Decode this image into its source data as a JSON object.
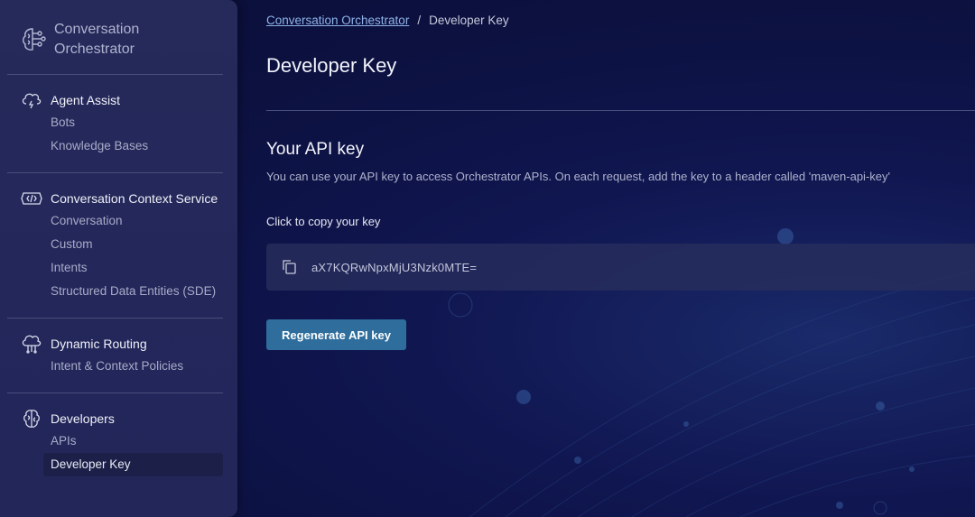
{
  "brand": {
    "name_line1": "Conversation",
    "name_line2": "Orchestrator",
    "icon": "brain-circuit-icon"
  },
  "sidebar": {
    "sections": [
      {
        "title": "Agent Assist",
        "icon": "cloud-lightning-icon",
        "items": [
          {
            "label": "Bots"
          },
          {
            "label": "Knowledge Bases"
          }
        ]
      },
      {
        "title": "Conversation Context Service",
        "icon": "code-tag-icon",
        "items": [
          {
            "label": "Conversation"
          },
          {
            "label": "Custom"
          },
          {
            "label": "Intents"
          },
          {
            "label": "Structured Data Entities (SDE)"
          }
        ]
      },
      {
        "title": "Dynamic Routing",
        "icon": "cloud-routing-icon",
        "items": [
          {
            "label": "Intent & Context Policies"
          }
        ]
      },
      {
        "title": "Developers",
        "icon": "brain-icon",
        "items": [
          {
            "label": "APIs"
          },
          {
            "label": "Developer Key",
            "active": true
          }
        ]
      }
    ]
  },
  "breadcrumb": {
    "parent": "Conversation Orchestrator",
    "separator": "/",
    "current": "Developer Key"
  },
  "page": {
    "title": "Developer Key",
    "api_section_title": "Your API key",
    "api_description": "You can use your API key to access Orchestrator APIs. On each request, add the key to a header called 'maven-api-key'",
    "copy_label": "Click to copy your key",
    "api_key": "aX7KQRwNpxMjU3Nzk0MTE=",
    "copy_icon": "copy-icon",
    "regenerate_label": "Regenerate API key"
  },
  "colors": {
    "accent_button": "#2e6d9c",
    "link": "#8fb3e8",
    "sidebar_bg": "#262a5a",
    "main_bg": "#0d1240"
  }
}
